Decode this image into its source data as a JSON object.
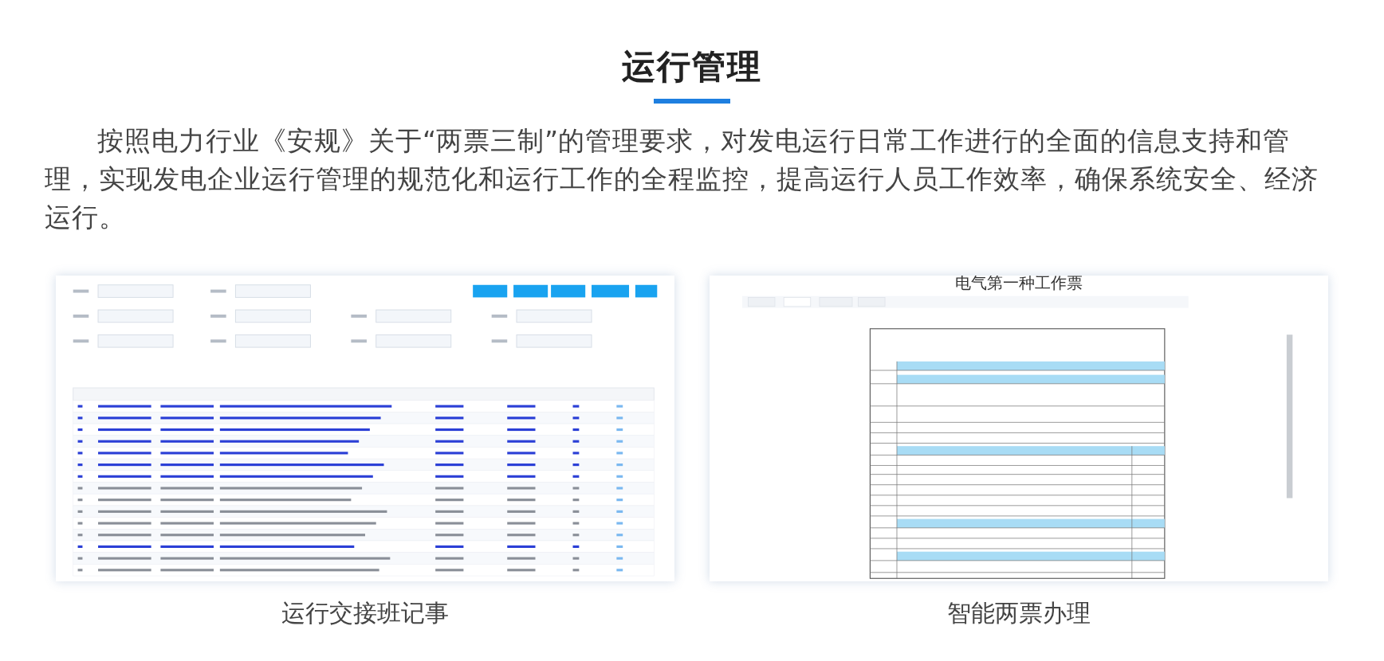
{
  "section": {
    "title": "运行管理"
  },
  "intro": "按照电力行业《安规》关于“两票三制”的管理要求，对发电运行日常工作进行的全面的信息支持和管理，实现发电企业运行管理的规范化和运行工作的全程监控，提高运行人员工作效率，确保系统安全、经济运行。",
  "figures": [
    {
      "kind": "log-table",
      "caption": "运行交接班记事"
    },
    {
      "kind": "work-ticket",
      "title": "电气第一种工作票",
      "caption": "智能两票办理"
    }
  ]
}
